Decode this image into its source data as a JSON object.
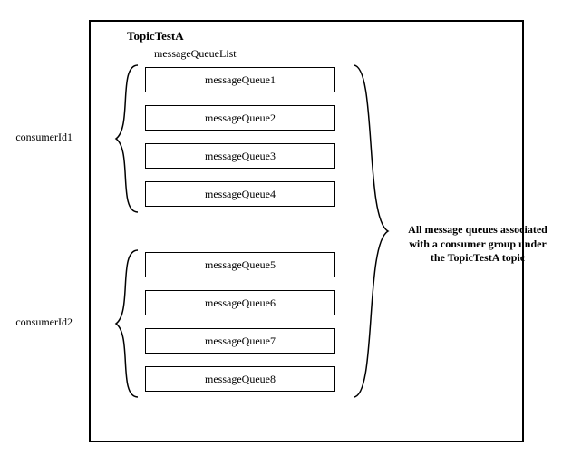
{
  "topic": {
    "title": "TopicTestA",
    "queueListLabel": "messageQueueList"
  },
  "queues": {
    "q1": "messageQueue1",
    "q2": "messageQueue2",
    "q3": "messageQueue3",
    "q4": "messageQueue4",
    "q5": "messageQueue5",
    "q6": "messageQueue6",
    "q7": "messageQueue7",
    "q8": "messageQueue8"
  },
  "consumers": {
    "c1": "consumerId1",
    "c2": "consumerId2"
  },
  "caption": "All message queues associated with a consumer group under the TopicTestA topic"
}
